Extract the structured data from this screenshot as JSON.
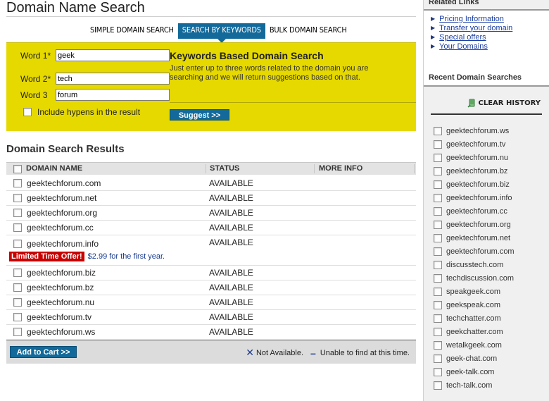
{
  "main": {
    "title": "Domain Name Search",
    "tabs": [
      {
        "label": "SIMPLE DOMAIN SEARCH",
        "active": false
      },
      {
        "label": "SEARCH BY KEYWORDS",
        "active": true
      },
      {
        "label": "BULK DOMAIN SEARCH",
        "active": false
      }
    ],
    "keywords": {
      "word1_label": "Word 1*",
      "word1_value": "geek",
      "word2_label": "Word 2*",
      "word2_value": "tech",
      "word3_label": "Word 3",
      "word3_value": "forum",
      "hyphens_label": "Include hypens in the result",
      "heading": "Keywords Based Domain Search",
      "description": "Just enter up to three words related to the domain you are searching and we will return suggestions based on that.",
      "suggest_label": "Suggest >>"
    },
    "results": {
      "title": "Domain Search Results",
      "col_domain": "DOMAIN NAME",
      "col_status": "STATUS",
      "col_more": "MORE INFO",
      "rows": [
        {
          "domain": "geektechforum.com",
          "status": "AVAILABLE"
        },
        {
          "domain": "geektechforum.net",
          "status": "AVAILABLE"
        },
        {
          "domain": "geektechforum.org",
          "status": "AVAILABLE"
        },
        {
          "domain": "geektechforum.cc",
          "status": "AVAILABLE"
        },
        {
          "domain": "geektechforum.info",
          "status": "AVAILABLE"
        },
        {
          "domain": "geektechforum.biz",
          "status": "AVAILABLE"
        },
        {
          "domain": "geektechforum.bz",
          "status": "AVAILABLE"
        },
        {
          "domain": "geektechforum.nu",
          "status": "AVAILABLE"
        },
        {
          "domain": "geektechforum.tv",
          "status": "AVAILABLE"
        },
        {
          "domain": "geektechforum.ws",
          "status": "AVAILABLE"
        }
      ],
      "offer_badge": "Limited Time Offer!",
      "offer_text": "$2.99 for the first year.",
      "add_to_cart": "Add to Cart >>",
      "legend_not_available": "Not Available.",
      "legend_unable": "Unable to find at this time."
    }
  },
  "sidebar": {
    "related_title": "Related Links",
    "related_links": [
      "Pricing Information",
      "Transfer your domain",
      "Special offers",
      "Your Domains"
    ],
    "recent_title": "Recent Domain Searches",
    "clear_history": "CLEAR HISTORY",
    "recent": [
      "geektechforum.ws",
      "geektechforum.tv",
      "geektechforum.nu",
      "geektechforum.bz",
      "geektechforum.biz",
      "geektechforum.info",
      "geektechforum.cc",
      "geektechforum.org",
      "geektechforum.net",
      "geektechforum.com",
      "discusstech.com",
      "techdiscussion.com",
      "speakgeek.com",
      "geekspeak.com",
      "techchatter.com",
      "geekchatter.com",
      "wetalkgeek.com",
      "geek-chat.com",
      "geek-talk.com",
      "tech-talk.com"
    ]
  },
  "colors": {
    "brand_blue": "#136a9a",
    "keyword_panel_yellow": "#e6d900",
    "offer_red": "#c80000",
    "link_blue": "#1a3ea3"
  },
  "icons": {
    "not_available": "x-icon",
    "unable": "dash-icon",
    "clear_history": "broom-icon",
    "related_bullet": "arrow-right-icon"
  }
}
